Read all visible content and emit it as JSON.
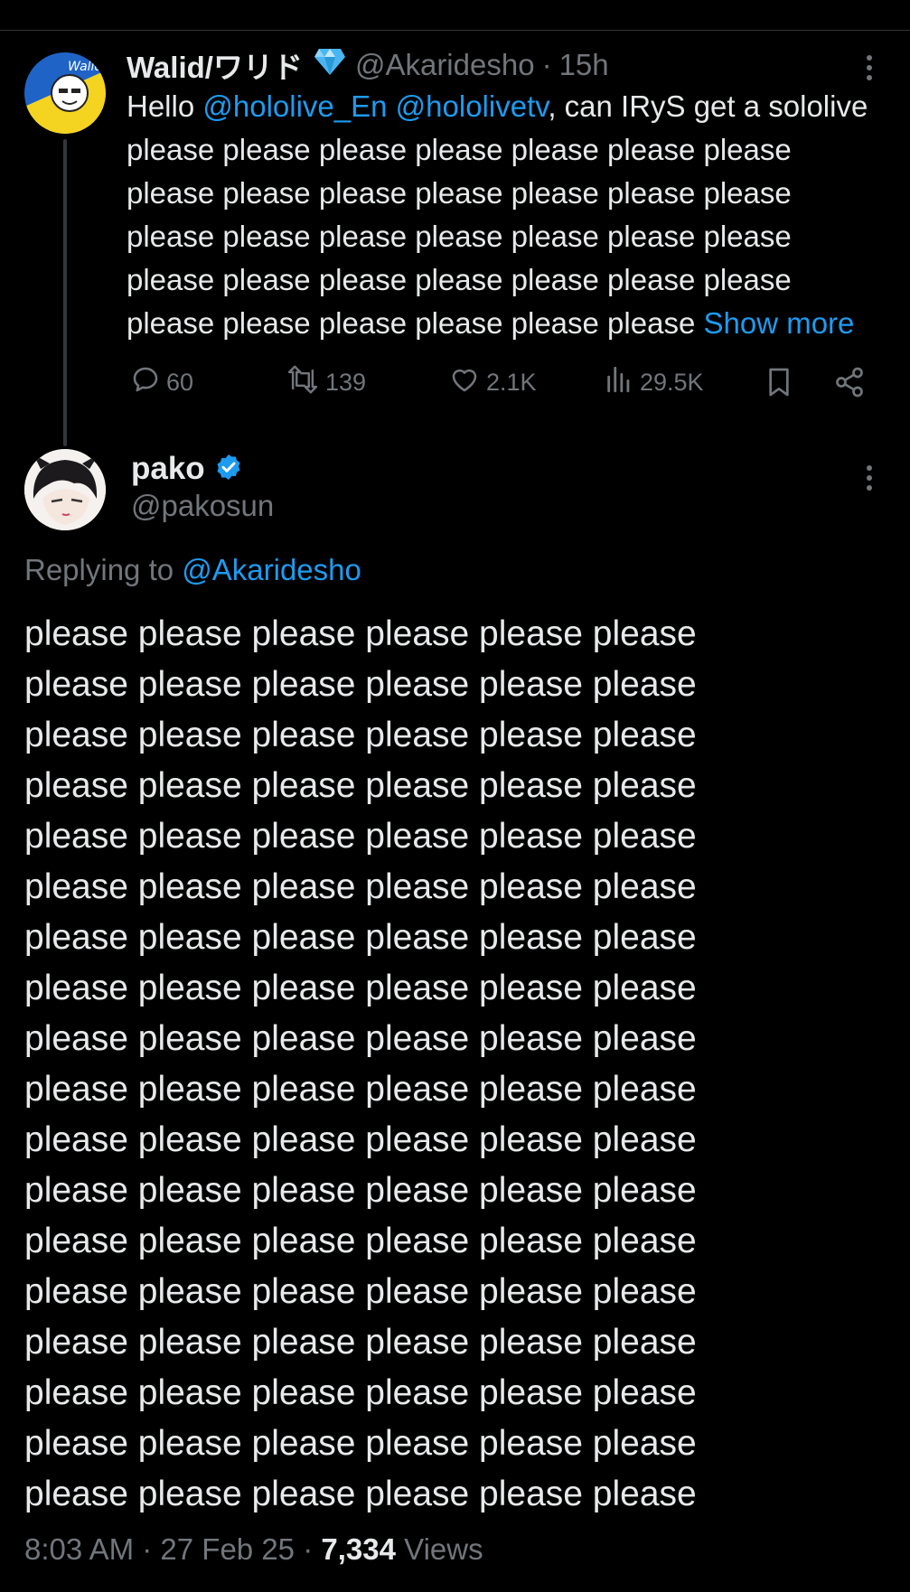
{
  "parent_tweet": {
    "display_name": "Walid/ワリド",
    "handle": "@Akaridesho",
    "separator": "·",
    "time": "15h",
    "text_prefix": "Hello ",
    "mention_1": "@hololive_En",
    "mention_2": "@hololivetv",
    "text_body": ", can IRyS get a sololive please please please please please please please please please please please please please please please please please please please please please please please please please please please please please please please please please please ",
    "show_more": "Show more",
    "stats": {
      "replies": "60",
      "reposts": "139",
      "likes": "2.1K",
      "views": "29.5K"
    }
  },
  "reply_tweet": {
    "display_name": "pako",
    "handle": "@pakosun",
    "replying_prefix": "Replying to ",
    "replying_handle": "@Akaridesho",
    "body": "please please please please please please\nplease please please please please please\nplease please please please please please\nplease please please please please please\nplease please please please please please\nplease please please please please please\nplease please please please please please\nplease please please please please please\nplease please please please please please\nplease please please please please please\nplease please please please please please\nplease please please please please please\nplease please please please please please\nplease please please please please please\nplease please please please please please\nplease please please please please please\nplease please please please please please\nplease please please please please please",
    "time": "8:03 AM",
    "sep_1": "·",
    "date": "27 Feb 25",
    "sep_2": "·",
    "views_count": "7,334",
    "views_label": "Views"
  },
  "colors": {
    "background": "#000000",
    "text": "#e7e9ea",
    "secondary": "#71767b",
    "accent": "#1d9bf0"
  },
  "icons": [
    "diamond-icon",
    "more-icon",
    "reply-icon",
    "repost-icon",
    "like-icon",
    "views-icon",
    "bookmark-icon",
    "share-icon",
    "verified-badge-icon"
  ]
}
